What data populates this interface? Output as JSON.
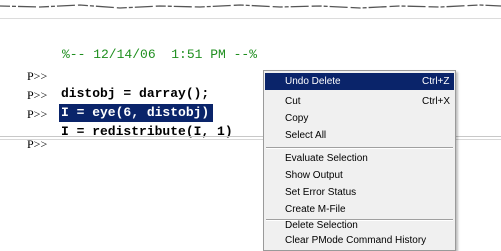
{
  "history": {
    "comment": "%-- 12/14/06  1:51 PM --%",
    "lines": [
      {
        "prompt": "P>>",
        "command": "distobj = darray();"
      },
      {
        "prompt": "P>>",
        "command": "I = eye(6, distobj)"
      },
      {
        "prompt": "P>>",
        "command": "I = redistribute(I, 1)"
      }
    ],
    "current_prompt": "P>>"
  },
  "context_menu": {
    "items": [
      {
        "label": "Undo Delete",
        "shortcut": "Ctrl+Z"
      },
      {
        "label": "Cut",
        "shortcut": "Ctrl+X"
      },
      {
        "label": "Copy",
        "shortcut": ""
      },
      {
        "label": "Select All",
        "shortcut": ""
      },
      {
        "label": "Evaluate Selection",
        "shortcut": ""
      },
      {
        "label": "Show Output",
        "shortcut": ""
      },
      {
        "label": "Set Error Status",
        "shortcut": ""
      },
      {
        "label": "Create M-File",
        "shortcut": ""
      },
      {
        "label": "Delete Selection",
        "shortcut": ""
      },
      {
        "label": "Clear PMode Command History",
        "shortcut": ""
      }
    ]
  },
  "colors": {
    "selection": "#0a246a",
    "comment": "#1f8f1f",
    "menu_background": "#f0f0f0"
  }
}
